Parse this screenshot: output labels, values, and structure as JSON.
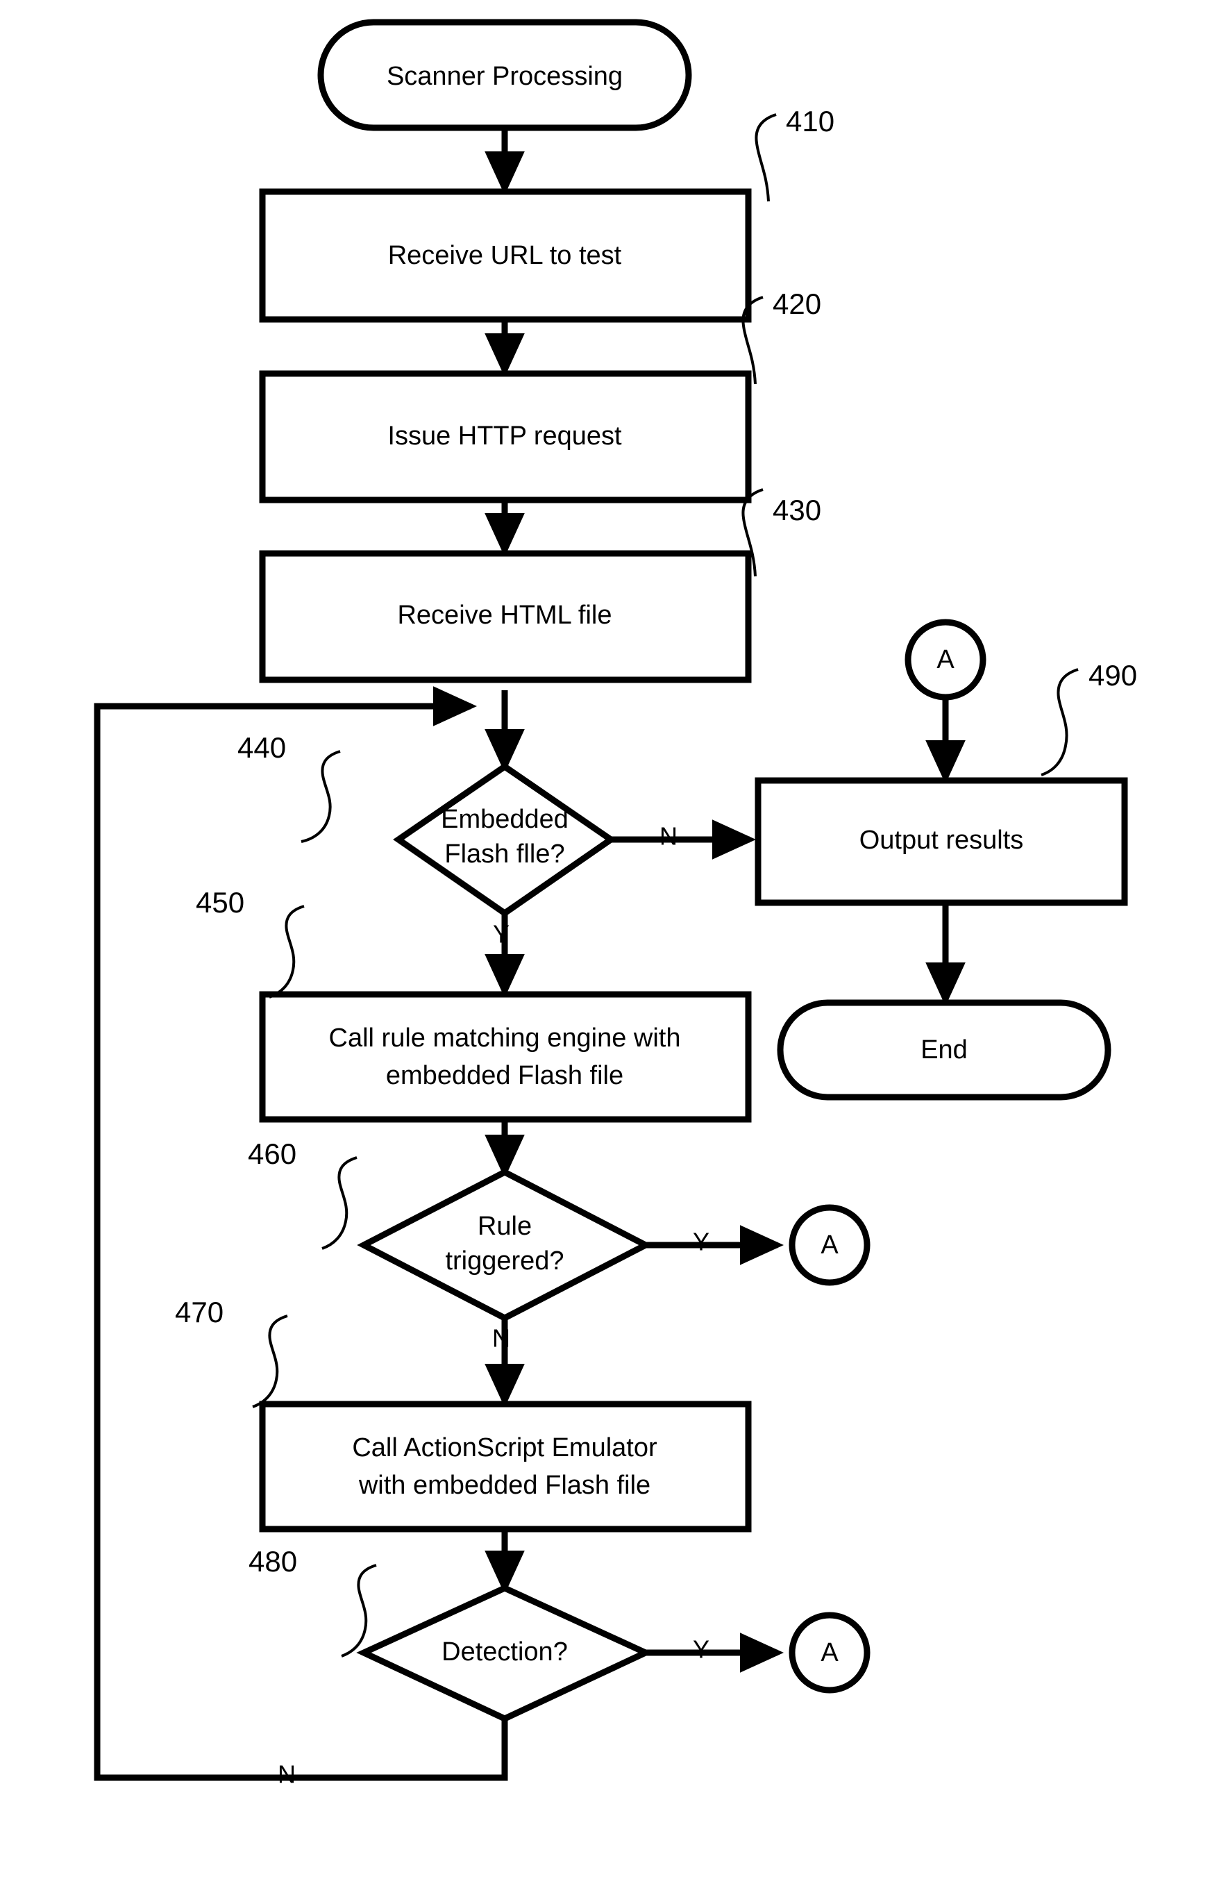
{
  "figure": {
    "type": "flowchart",
    "orientation": "vertical",
    "background_color": "#ffffff",
    "line_color": "#000000"
  },
  "nodes": {
    "start": {
      "label": "Scanner Processing",
      "shape": "terminator"
    },
    "receive_url": {
      "label": "Receive URL to test",
      "shape": "process",
      "ref": "410"
    },
    "issue_http": {
      "label": "Issue HTTP request",
      "shape": "process",
      "ref": "420"
    },
    "receive_html": {
      "label": "Receive HTML file",
      "shape": "process",
      "ref": "430"
    },
    "embedded_flash": {
      "label_line1": "Embedded",
      "label_line2": "Flash flle?",
      "shape": "decision",
      "ref": "440"
    },
    "call_rule_engine": {
      "label_line1": "Call rule matching engine with",
      "label_line2": "embedded Flash file",
      "shape": "process",
      "ref": "450"
    },
    "rule_triggered": {
      "label_line1": "Rule",
      "label_line2": "triggered?",
      "shape": "decision",
      "ref": "460"
    },
    "call_emulator": {
      "label_line1": "Call ActionScript Emulator",
      "label_line2": "with embedded Flash file",
      "shape": "process",
      "ref": "470"
    },
    "detection": {
      "label": "Detection?",
      "shape": "decision",
      "ref": "480"
    },
    "output_results": {
      "label": "Output results",
      "shape": "process",
      "ref": "490"
    },
    "end": {
      "label": "End",
      "shape": "terminator"
    },
    "connector_a_top": {
      "label": "A",
      "shape": "connector"
    },
    "connector_a_rule": {
      "label": "A",
      "shape": "connector"
    },
    "connector_a_detection": {
      "label": "A",
      "shape": "connector"
    }
  },
  "branch_labels": {
    "embedded_flash_no": "N",
    "embedded_flash_yes": "Y",
    "rule_triggered_yes": "Y",
    "rule_triggered_no": "N",
    "detection_yes": "Y",
    "detection_no": "N"
  },
  "reference_numbers": {
    "r410": "410",
    "r420": "420",
    "r430": "430",
    "r440": "440",
    "r450": "450",
    "r460": "460",
    "r470": "470",
    "r480": "480",
    "r490": "490"
  }
}
